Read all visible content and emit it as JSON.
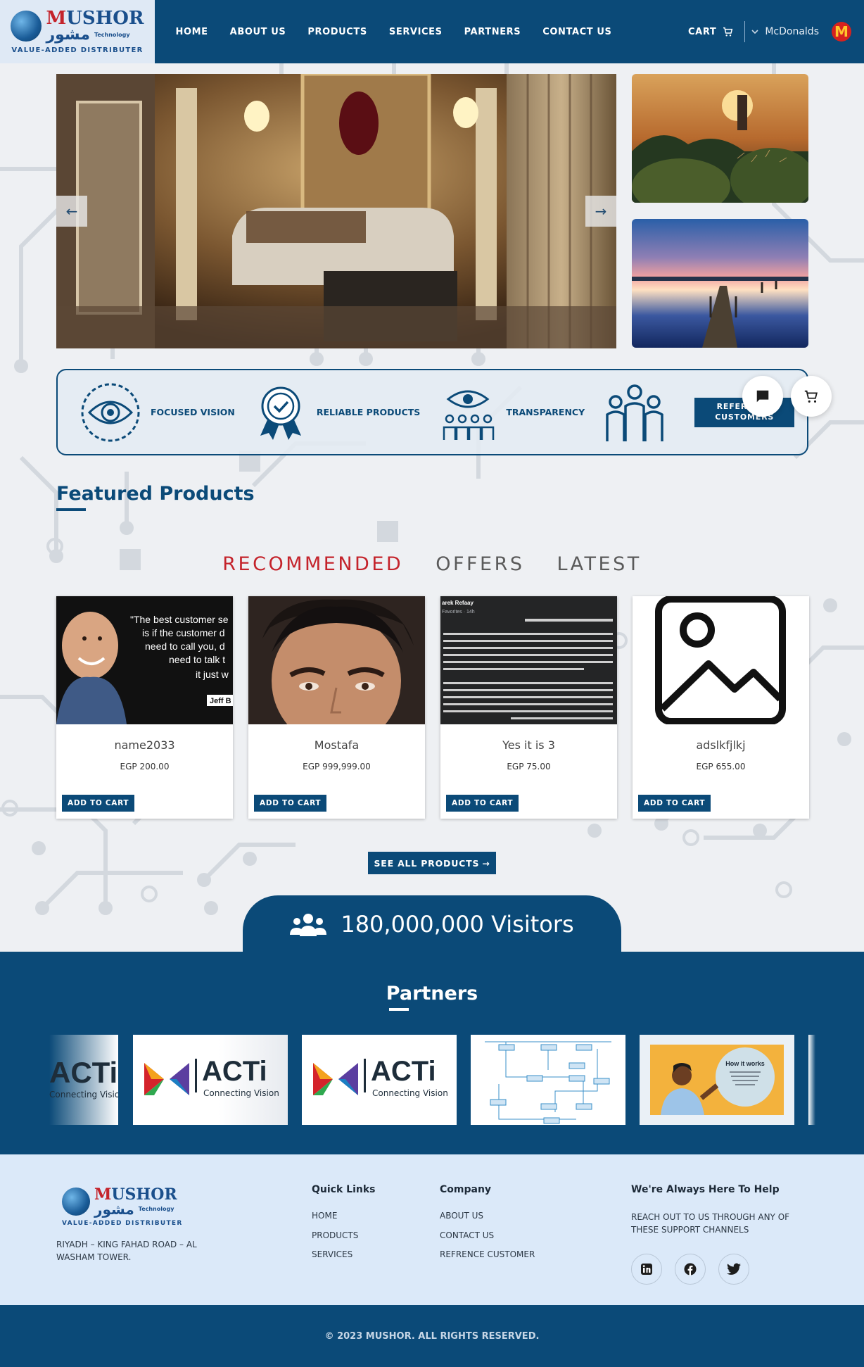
{
  "brand": {
    "name_latin": "MUSHOR",
    "name_arabic": "مشور",
    "technology": "Technology",
    "tagline": "VALUE-ADDED DISTRIBUTER"
  },
  "nav": {
    "items": [
      {
        "label": "HOME"
      },
      {
        "label": "ABOUT US"
      },
      {
        "label": "PRODUCTS"
      },
      {
        "label": "SERVICES"
      },
      {
        "label": "PARTNERS"
      },
      {
        "label": "CONTACT US"
      }
    ],
    "cart_label": "CART",
    "user_name": "McDonalds"
  },
  "values": {
    "items": [
      {
        "label": "FOCUSED VISION",
        "icon": "eye-icon"
      },
      {
        "label": "RELIABLE PRODUCTS",
        "icon": "award-ribbon-icon"
      },
      {
        "label": "TRANSPARENCY",
        "icon": "team-vision-icon"
      },
      {
        "label": "",
        "icon": "people-group-icon"
      }
    ],
    "reference_button": "REFERENCE CUSTOMERS"
  },
  "featured": {
    "title": "Featured Products",
    "tabs": [
      {
        "label": "RECOMMENDED",
        "active": true
      },
      {
        "label": "OFFERS",
        "active": false
      },
      {
        "label": "LATEST",
        "active": false
      }
    ],
    "products": [
      {
        "name": "name2033",
        "price": "EGP 200.00",
        "image": "portrait-quote",
        "quote_lines": [
          "\"The best customer se",
          "is if the customer d",
          "need to call you, d",
          "need to talk t",
          "it just w"
        ],
        "quote_author": "Jeff B"
      },
      {
        "name": "Mostafa",
        "price": "EGP 999,999.00",
        "image": "portrait-man"
      },
      {
        "name": "Yes it is 3",
        "price": "EGP 75.00",
        "image": "arabic-post",
        "post_author": "arek Refaay",
        "post_meta": "Favorites · 14h"
      },
      {
        "name": "adslkfjlkj",
        "price": "EGP 655.00",
        "image": "placeholder-icon"
      }
    ],
    "add_to_cart": "ADD TO CART",
    "see_all": "SEE ALL PRODUCTS"
  },
  "visitors": {
    "count": "180,000,000 Visitors"
  },
  "partners": {
    "title": "Partners",
    "logos": [
      {
        "brand": "ACTi",
        "tagline": "Connecting Vision"
      },
      {
        "brand": "ACTi",
        "tagline": "Connecting Vision"
      },
      {
        "brand": "ACTi",
        "tagline": "Connecting Vision"
      },
      {
        "brand": "flow-diagram"
      },
      {
        "brand": "illustration",
        "heading": "How it works"
      }
    ]
  },
  "footer": {
    "address": "RIYADH – KING FAHAD ROAD – AL WASHAM TOWER.",
    "quick_links": {
      "title": "Quick Links",
      "items": [
        "HOME",
        "PRODUCTS",
        "SERVICES"
      ]
    },
    "company": {
      "title": "Company",
      "items": [
        "ABOUT US",
        "CONTACT US",
        "REFRENCE CUSTOMER"
      ]
    },
    "help": {
      "title": "We're Always Here To Help",
      "text": "REACH OUT TO US THROUGH ANY OF THESE SUPPORT CHANNELS"
    },
    "social": [
      "linkedin-icon",
      "facebook-icon",
      "twitter-icon"
    ],
    "copyright": "© 2023 MUSHOR. ALL RIGHTS RESERVED."
  },
  "colors": {
    "primary": "#0b4a78",
    "accent": "#c4232b",
    "footer_bg": "#dbe9f9"
  }
}
